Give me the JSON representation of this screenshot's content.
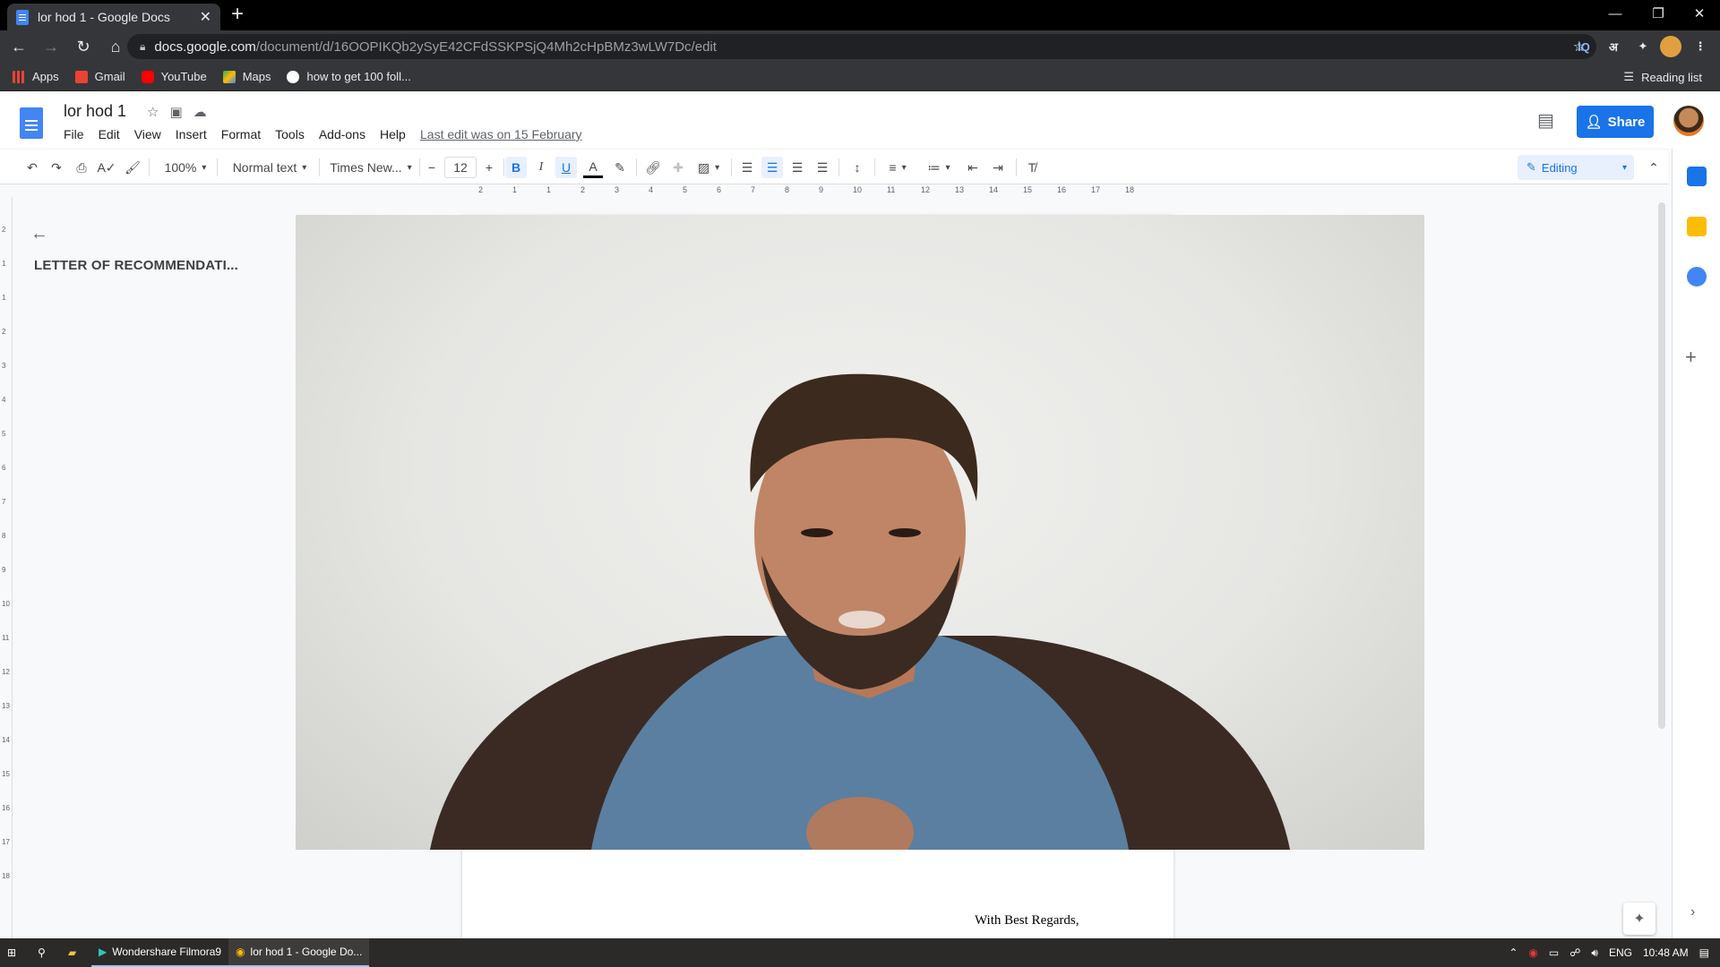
{
  "browser": {
    "tab_title": "lor hod 1 - Google Docs",
    "url_host": "docs.google.com",
    "url_path": "/document/d/16OOPIKQb2ySyE42CFdSSKPSjQ4Mh2cHpBMz3wLW7Dc/edit",
    "bookmarks": [
      "Apps",
      "Gmail",
      "YouTube",
      "Maps",
      "how to get 100 foll..."
    ],
    "reading_list": "Reading list",
    "ext_iq": "IQ",
    "ext_lang": "अ"
  },
  "docs": {
    "title": "lor hod 1",
    "menu": [
      "File",
      "Edit",
      "View",
      "Insert",
      "Format",
      "Tools",
      "Add-ons",
      "Help"
    ],
    "last_edit": "Last edit was on 15 February",
    "share_label": "Share",
    "mode_label": "Editing"
  },
  "toolbar": {
    "zoom": "100%",
    "style": "Normal text",
    "font": "Times New...",
    "font_size": "12"
  },
  "ruler": {
    "ticks": [
      "2",
      "1",
      "1",
      "2",
      "3",
      "4",
      "5",
      "6",
      "7",
      "8",
      "9",
      "10",
      "11",
      "12",
      "13",
      "14",
      "15",
      "16",
      "17",
      "18"
    ]
  },
  "vruler": {
    "ticks": [
      "2",
      "1",
      "1",
      "2",
      "3",
      "4",
      "5",
      "6",
      "7",
      "8",
      "9",
      "10",
      "11",
      "12",
      "13",
      "14",
      "15",
      "16",
      "17",
      "18"
    ]
  },
  "outline": {
    "heading": "LETTER OF RECOMMENDATI..."
  },
  "document": {
    "closing": "With Best Regards,"
  },
  "taskbar": {
    "apps": [
      "Wondershare Filmora9",
      "lor hod 1 - Google Do..."
    ],
    "lang": "ENG",
    "time": "10:48 AM"
  }
}
